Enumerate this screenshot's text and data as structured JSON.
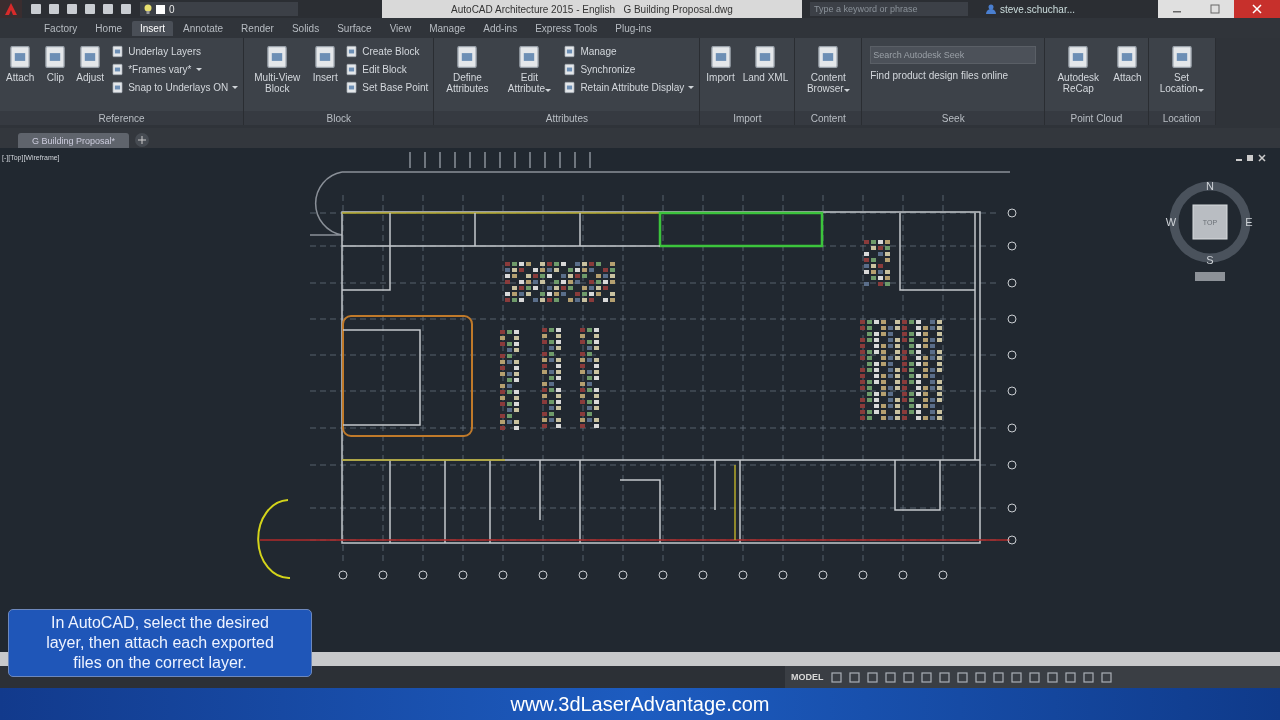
{
  "title_bar": {
    "layer": "0",
    "title": "AutoCAD Architecture 2015 - English   G Building Proposal.dwg",
    "search": {
      "placeholder": "Type a keyword or phrase"
    },
    "user": "steve.schuchar..."
  },
  "tabs": [
    {
      "label": "Factory",
      "selected": false
    },
    {
      "label": "Home",
      "selected": false
    },
    {
      "label": "Insert",
      "selected": true
    },
    {
      "label": "Annotate",
      "selected": false
    },
    {
      "label": "Render",
      "selected": false
    },
    {
      "label": "Solids",
      "selected": false
    },
    {
      "label": "Surface",
      "selected": false
    },
    {
      "label": "View",
      "selected": false
    },
    {
      "label": "Manage",
      "selected": false
    },
    {
      "label": "Add-ins",
      "selected": false
    },
    {
      "label": "Express Tools",
      "selected": false
    },
    {
      "label": "Plug-ins",
      "selected": false
    }
  ],
  "ribbon": {
    "panels": [
      {
        "title": "Reference",
        "items": [
          {
            "kind": "large",
            "label": "Attach",
            "menu": false
          },
          {
            "kind": "large",
            "label": "Clip",
            "menu": false
          },
          {
            "kind": "large",
            "label": "Adjust",
            "menu": false
          },
          {
            "kind": "small",
            "label": "Underlay Layers",
            "menu": false
          },
          {
            "kind": "small",
            "label": "*Frames vary*",
            "menu": true
          },
          {
            "kind": "small",
            "label": "Snap to Underlays ON",
            "menu": true
          }
        ]
      },
      {
        "title": "Block",
        "items": [
          {
            "kind": "large",
            "label": "Multi-View Block",
            "menu": false
          },
          {
            "kind": "large",
            "label": "Insert",
            "menu": false
          },
          {
            "kind": "small",
            "label": "Create Block",
            "menu": false
          },
          {
            "kind": "small",
            "label": "Edit Block",
            "menu": false
          },
          {
            "kind": "small",
            "label": "Set Base Point",
            "menu": false
          }
        ]
      },
      {
        "title": "Attributes",
        "items": [
          {
            "kind": "large",
            "label": "Define Attributes",
            "menu": false
          },
          {
            "kind": "large",
            "label": "Edit Attribute",
            "menu": true
          },
          {
            "kind": "small",
            "label": "Manage",
            "menu": false
          },
          {
            "kind": "small",
            "label": "Synchronize",
            "menu": false
          },
          {
            "kind": "small",
            "label": "Retain Attribute Display",
            "menu": true
          }
        ]
      },
      {
        "title": "Import",
        "items": [
          {
            "kind": "large",
            "label": "Import",
            "menu": false
          },
          {
            "kind": "large",
            "label": "Land XML",
            "menu": false
          }
        ]
      },
      {
        "title": "Content",
        "items": [
          {
            "kind": "large",
            "label": "Content Browser",
            "menu": true
          }
        ]
      },
      {
        "title": "Seek",
        "items": [
          {
            "kind": "search",
            "placeholder": "Search Autodesk Seek",
            "label": "Find product design files online"
          }
        ]
      },
      {
        "title": "Point Cloud",
        "items": [
          {
            "kind": "large",
            "label": "Autodesk ReCap",
            "menu": false
          },
          {
            "kind": "large",
            "label": "Attach",
            "menu": false
          }
        ]
      },
      {
        "title": "Location",
        "items": [
          {
            "kind": "large",
            "label": "Set Location",
            "menu": true
          }
        ]
      }
    ]
  },
  "document_tabs": [
    {
      "label": "G Building Proposal*",
      "selected": true
    }
  ],
  "viewport": {
    "label": "[-][Top][Wireframe]",
    "compass": {
      "north": "N",
      "east": "E",
      "south": "S",
      "west": "W",
      "face": "TOP"
    }
  },
  "caption": "In AutoCAD, select the desired layer, then attach each exported files on the correct layer.",
  "status_bar": {
    "space": "MODEL"
  },
  "footer": "www.3dLaserAdvantage.com"
}
